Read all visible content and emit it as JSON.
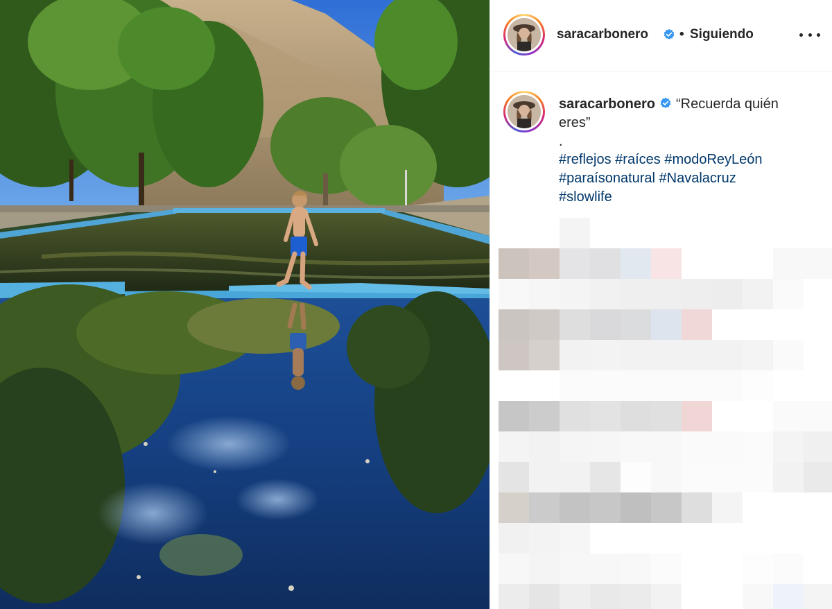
{
  "post": {
    "username": "saracarbonero",
    "verified": true,
    "follow_separator": "•",
    "follow_status": "Siguiendo",
    "more_icon": "more-horizontal-icon"
  },
  "caption": {
    "username": "saracarbonero",
    "text_line1": "“Recuerda quién",
    "text_line2": "eres”",
    "separator": ".",
    "hashtags": [
      "#reflejos",
      "#raíces",
      "#modoReyLeón",
      "#paraísonatural",
      "#Navalacruz",
      "#slowlife"
    ]
  },
  "colors": {
    "verified_badge": "#3897f0",
    "hashtag": "#00376b",
    "text": "#262626",
    "divider": "#efefef"
  }
}
